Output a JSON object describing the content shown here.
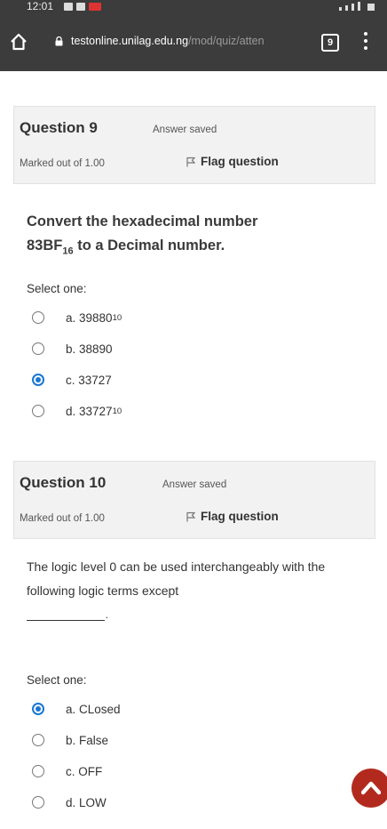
{
  "status_bar": {
    "time": "12:01"
  },
  "browser": {
    "url_domain": "testonline.unilag.edu.ng",
    "url_path": "/mod/quiz/atten",
    "tab_count": "9"
  },
  "q9": {
    "title": "Question 9",
    "state": "Answer saved",
    "marks": "Marked out of 1.00",
    "flag_label": "Flag question",
    "text_line1": "Convert the hexadecimal number",
    "text_num": "83BF",
    "text_base": "16",
    "text_tail": " to a Decimal number.",
    "select_one": "Select one:",
    "options": [
      {
        "label": "a. 39880",
        "sub": "10",
        "selected": false
      },
      {
        "label": "b. 38890",
        "sub": "",
        "selected": false
      },
      {
        "label": "c. 33727",
        "sub": "",
        "selected": true
      },
      {
        "label": "d. 33727",
        "sub": "10",
        "selected": false
      }
    ]
  },
  "q10": {
    "title": "Question 10",
    "state": "Answer saved",
    "marks": "Marked out of 1.00",
    "flag_label": "Flag question",
    "text": "The logic  level 0 can be used interchangeably with the following logic terms except",
    "blank_suffix": ".",
    "select_one": "Select one:",
    "options": [
      {
        "label": "a. CLosed",
        "selected": true
      },
      {
        "label": "b. False",
        "selected": false
      },
      {
        "label": "c. OFF",
        "selected": false
      },
      {
        "label": "d. LOW",
        "selected": false
      }
    ]
  },
  "colors": {
    "topbar": "#3c3c3c",
    "selected_radio": "#1976d2",
    "fab": "#b22a1e"
  }
}
